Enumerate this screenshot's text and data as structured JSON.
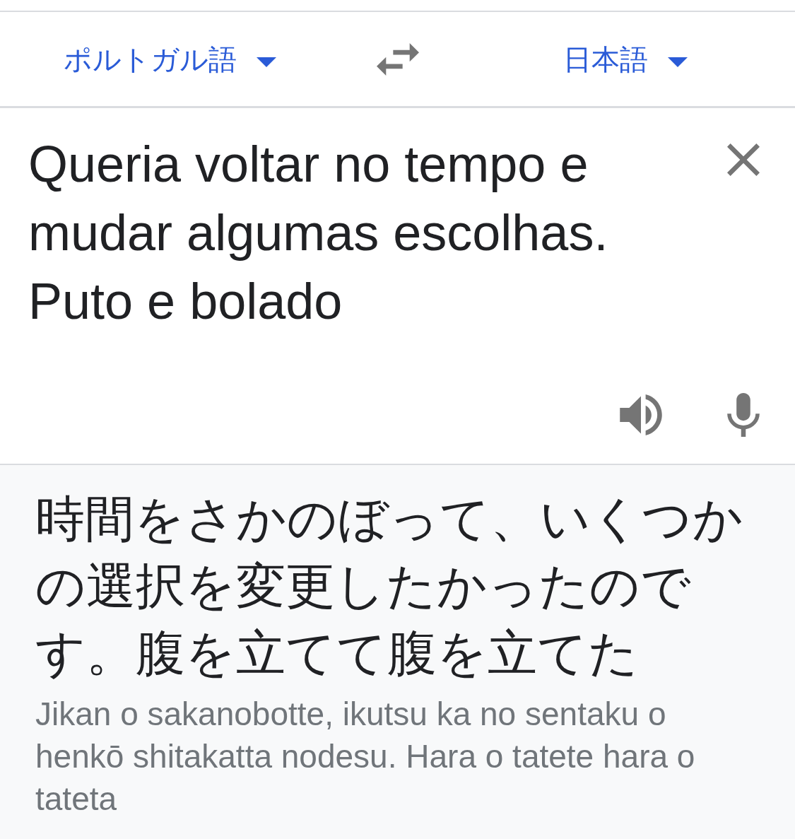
{
  "language_bar": {
    "source_language": {
      "label": "ポルトガル語"
    },
    "target_language": {
      "label": "日本語"
    }
  },
  "source": {
    "value": "Queria voltar no tempo e mudar algumas escolhas. Puto e bolado"
  },
  "translation": {
    "text": "時間をさかのぼって、いくつかの選択を変更したかったのです。腹を立てて腹を立てた",
    "romanization": "Jikan o sakanobotte, ikutsu ka no sentaku o henkō shitakatta nodesu. Hara o tatete hara o tateta"
  }
}
